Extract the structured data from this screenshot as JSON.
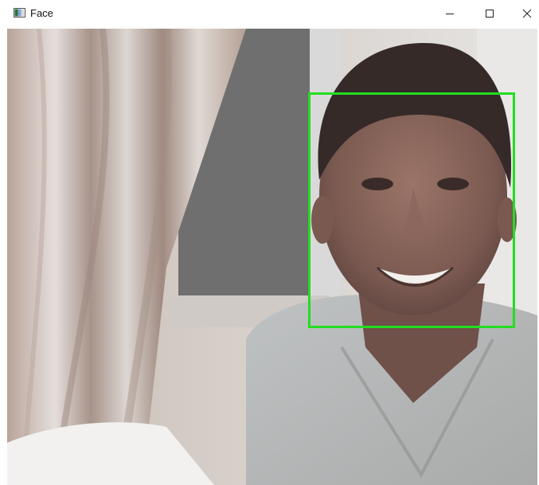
{
  "window": {
    "title": "Face",
    "icon": "opencv-window-icon",
    "controls": {
      "minimize": "minimize-icon",
      "maximize": "maximize-icon",
      "close": "close-icon"
    }
  },
  "overlay": {
    "detection_box_color": "#22dd22"
  }
}
